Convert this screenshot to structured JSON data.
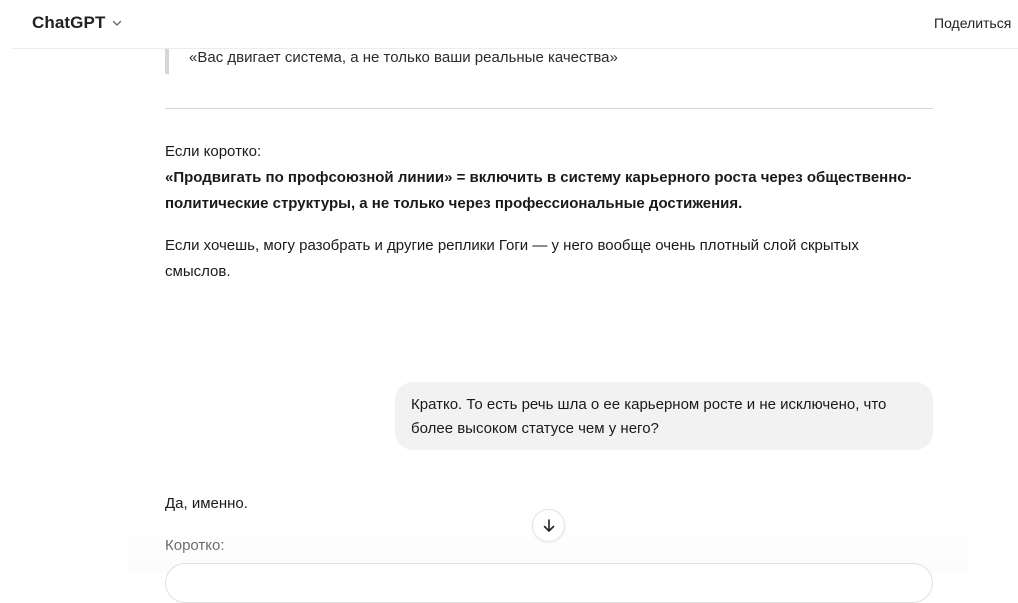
{
  "header": {
    "model_name": "ChatGPT",
    "share_label": "Поделиться"
  },
  "messages": {
    "quote_text": "«Вас двигает система, а не только ваши реальные качества»",
    "summary_intro": "Если коротко:",
    "summary_bold_line1": "«Продвигать по профсоюзной линии» = включить в систему карьерного роста через общественно-",
    "summary_bold_line2": "политические структуры, а не только через профессиональные достижения.",
    "offer_line1": "Если хочешь, могу разобрать и другие реплики Гоги — у него вообще очень плотный слой скрытых",
    "offer_line2": "смыслов.",
    "user_line1": "Кратко. То есть речь шла о ее карьерном росте и не исключено, что",
    "user_line2": "более высоком статусе чем у него?",
    "reply_line1": "Да, именно.",
    "reply_line2": "Коротко:"
  },
  "icons": {
    "chevron": "chevron-down-icon",
    "share": "share-icon",
    "scroll": "arrow-down-icon"
  }
}
